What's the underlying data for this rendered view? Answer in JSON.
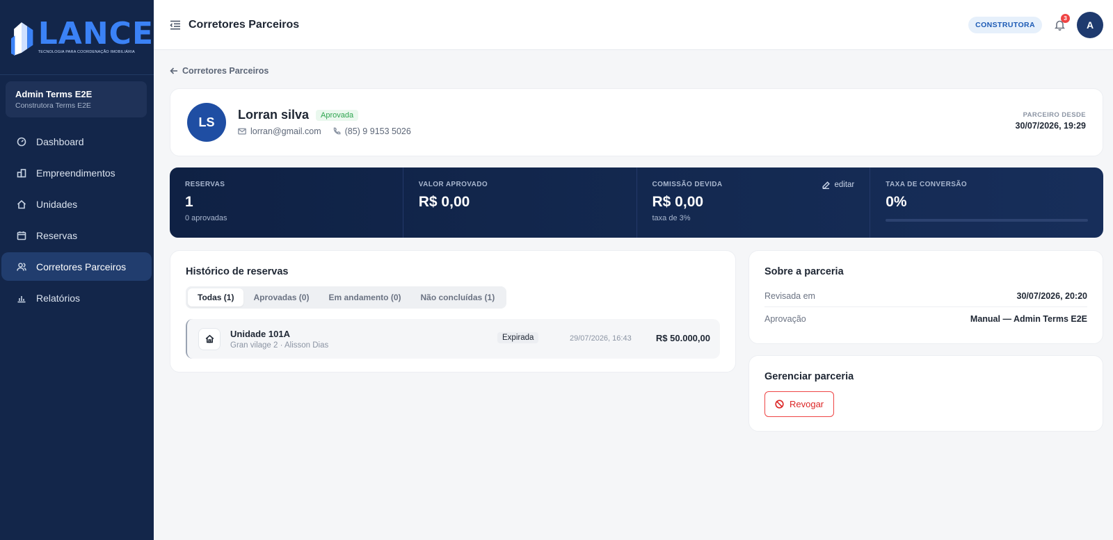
{
  "brand": {
    "name": "LANCE",
    "tagline": "TECNOLOGIA PARA COORDENAÇÃO IMOBILIÁRIA",
    "color": "#3b82f6"
  },
  "account": {
    "name": "Admin Terms E2E",
    "company": "Construtora Terms E2E"
  },
  "sidebar": {
    "items": [
      {
        "label": "Dashboard",
        "icon": "gauge-icon"
      },
      {
        "label": "Empreendimentos",
        "icon": "buildings-icon"
      },
      {
        "label": "Unidades",
        "icon": "home-icon"
      },
      {
        "label": "Reservas",
        "icon": "calendar-icon"
      },
      {
        "label": "Corretores Parceiros",
        "icon": "users-icon",
        "active": true
      },
      {
        "label": "Relatórios",
        "icon": "bar-chart-icon"
      }
    ]
  },
  "header": {
    "title": "Corretores Parceiros",
    "role": "CONSTRUTORA",
    "notifications": "3",
    "avatar_initial": "A"
  },
  "breadcrumb": {
    "back_label": "Corretores Parceiros"
  },
  "profile": {
    "initials": "LS",
    "name": "Lorran silva",
    "status": "Aprovada",
    "email": "lorran@gmail.com",
    "phone": "(85) 9 9153 5026",
    "partner_since_label": "PARCEIRO DESDE",
    "partner_since": "30/07/2026, 19:29"
  },
  "stats": {
    "reservas": {
      "label": "RESERVAS",
      "value": "1",
      "sub": "0 aprovadas"
    },
    "valor": {
      "label": "VALOR APROVADO",
      "value": "R$ 0,00"
    },
    "comissao": {
      "label": "COMISSÃO DEVIDA",
      "value": "R$ 0,00",
      "sub": "taxa de 3%",
      "edit_label": "editar"
    },
    "conversao": {
      "label": "TAXA DE CONVERSÃO",
      "value": "0%",
      "progress": 0
    }
  },
  "history": {
    "title": "Histórico de reservas",
    "tabs": [
      {
        "label": "Todas (1)",
        "active": true
      },
      {
        "label": "Aprovadas (0)"
      },
      {
        "label": "Em andamento (0)"
      },
      {
        "label": "Não concluídas (1)"
      }
    ],
    "rows": [
      {
        "unit": "Unidade 101A",
        "subtitle": "Gran vilage 2 · Alisson Dias",
        "status": "Expirada",
        "date": "29/07/2026, 16:43",
        "value": "R$ 50.000,00"
      }
    ]
  },
  "about": {
    "title": "Sobre a parceria",
    "reviewed_label": "Revisada em",
    "reviewed_value": "30/07/2026, 20:20",
    "approval_label": "Aprovação",
    "approval_value": "Manual — Admin Terms E2E"
  },
  "manage": {
    "title": "Gerenciar parceria",
    "revoke_label": "Revogar"
  }
}
